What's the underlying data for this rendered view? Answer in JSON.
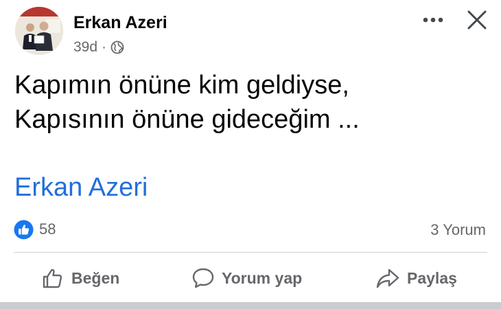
{
  "post": {
    "author": "Erkan Azeri",
    "time": "39d",
    "separator": "·",
    "text_line_1": "Kapımın önüne kim geldiyse,",
    "text_line_2": "Kapısının önüne gideceğim ...",
    "link_name": "Erkan Azeri"
  },
  "stats": {
    "reactions": "58",
    "comments": "3 Yorum"
  },
  "actions": {
    "like": "Beğen",
    "comment": "Yorum yap",
    "share": "Paylaş"
  },
  "icons": {
    "privacy": "globe-icon",
    "more": "more-dots-icon",
    "close": "close-icon",
    "reaction": "like-badge-icon",
    "like": "thumbs-up-icon",
    "comment": "comment-bubble-icon",
    "share": "share-arrow-icon"
  },
  "colors": {
    "link": "#216fdb",
    "like_badge": "#1877f2",
    "secondary_text": "#65676b"
  }
}
